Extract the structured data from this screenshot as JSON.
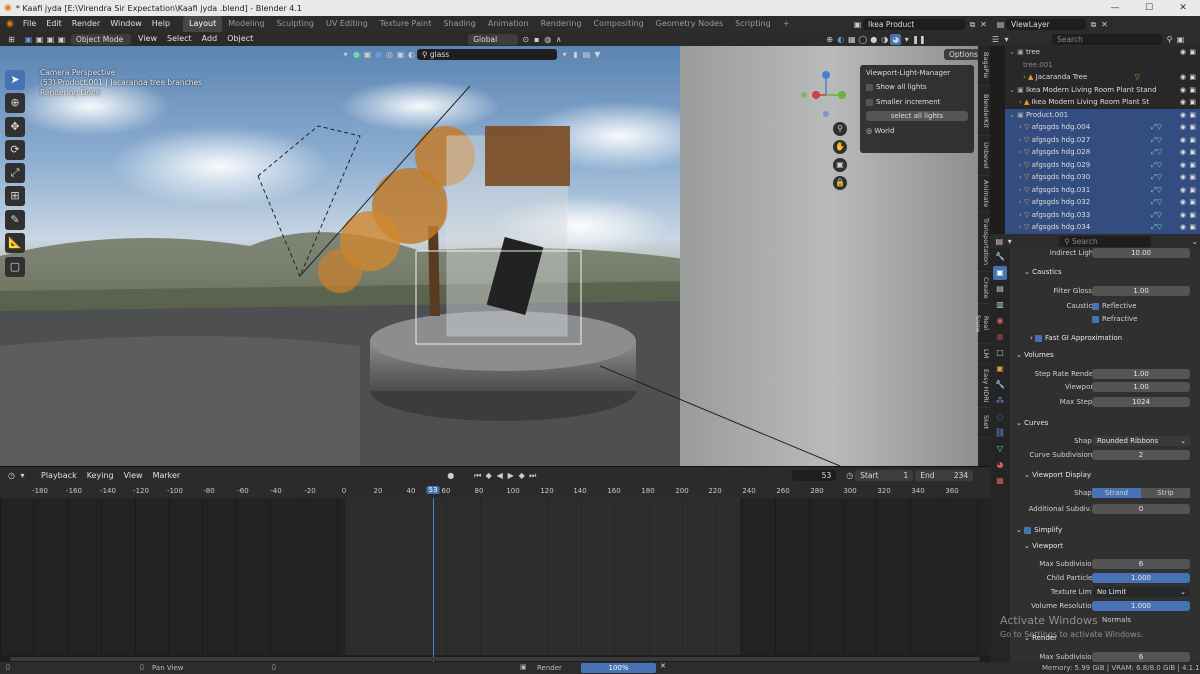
{
  "window": {
    "title": "* Kaafi jyda  [E:\\Virendra Sir Expectation\\Kaafi jyda .blend] - Blender 4.1"
  },
  "menu": [
    "File",
    "Edit",
    "Render",
    "Window",
    "Help"
  ],
  "workspaces": [
    "Layout",
    "Modeling",
    "Sculpting",
    "UV Editing",
    "Texture Paint",
    "Shading",
    "Animation",
    "Rendering",
    "Compositing",
    "Geometry Nodes",
    "Scripting"
  ],
  "topright": {
    "scene": "Ikea Product Visualization...",
    "view_layer": "ViewLayer"
  },
  "viewport_header": {
    "mode": "Object Mode",
    "menus": [
      "View",
      "Select",
      "Add",
      "Object"
    ],
    "orientation": "Global",
    "search_value": "glass",
    "options": "Options"
  },
  "viewport": {
    "line1": "Camera Perspective",
    "line2": "(53) Product.001 | Jacaranda tree branches",
    "line3": "Rendering Done"
  },
  "vlm_panel": {
    "title": "Viewport-Light-Manager",
    "show_all": "Show all lights",
    "smaller": "Smaller increment",
    "select_all": "select all lights",
    "world": "World"
  },
  "sidetabs": [
    "BagaPie",
    "BlenderKit",
    "Unbevel",
    "Animate",
    "Transportation",
    "Create",
    "Real Snow",
    "LM",
    "Easy HDRI",
    "Sket"
  ],
  "timeline": {
    "menus": [
      "Playback",
      "Keying",
      "View",
      "Marker"
    ],
    "current_frame": "53",
    "start_label": "Start",
    "start": "1",
    "end_label": "End",
    "end": "234",
    "ruler": [
      "-180",
      "-160",
      "-140",
      "-120",
      "-100",
      "-80",
      "-60",
      "-40",
      "-20",
      "0",
      "20",
      "40",
      "53",
      "60",
      "80",
      "100",
      "120",
      "140",
      "160",
      "180",
      "200",
      "220",
      "240",
      "260",
      "280",
      "300",
      "320",
      "340",
      "360"
    ]
  },
  "status": {
    "pan": "Pan View",
    "render": "Render",
    "progress": "100%",
    "memory": "Memory: 5.99 GiB | VRAM: 6.8/8.0 GiB | 4.1.1",
    "progress_value": 1.0
  },
  "outliner": {
    "search_placeholder": "Search",
    "items": [
      {
        "label": "tree",
        "sel": false
      },
      {
        "label": "tree.001",
        "sel": false
      },
      {
        "label": "Jacaranda Tree",
        "sel": false
      },
      {
        "label": "Ikea Modern Living Room Plant Stand",
        "sel": false
      },
      {
        "label": "Ikea Modern Living Room Plant St",
        "sel": false
      },
      {
        "label": "Product.001",
        "sel": true
      },
      {
        "label": "afgsgds hdg.004",
        "sel": true
      },
      {
        "label": "afgsgds hdg.027",
        "sel": true
      },
      {
        "label": "afgsgds hdg.028",
        "sel": true
      },
      {
        "label": "afgsgds hdg.029",
        "sel": true
      },
      {
        "label": "afgsgds hdg.030",
        "sel": true
      },
      {
        "label": "afgsgds hdg.031",
        "sel": true
      },
      {
        "label": "afgsgds hdg.032",
        "sel": true
      },
      {
        "label": "afgsgds hdg.033",
        "sel": true
      },
      {
        "label": "afgsgds hdg.034",
        "sel": true
      }
    ]
  },
  "properties": {
    "search_placeholder": "Search",
    "indirect_light_label": "Indirect Light",
    "indirect_light": "10.00",
    "caustics_section": "Caustics",
    "filter_glossy_label": "Filter Glossy",
    "filter_glossy": "1.00",
    "caustics_label": "Caustics",
    "reflective": "Reflective",
    "refractive": "Refractive",
    "fast_gi": "Fast GI Approximation",
    "volumes_section": "Volumes",
    "step_rate_render_label": "Step Rate Render",
    "step_rate_render": "1.00",
    "viewport_label": "Viewport",
    "viewport_val": "1.00",
    "max_steps_label": "Max Steps",
    "max_steps": "1024",
    "curves_section": "Curves",
    "shape_label": "Shape",
    "shape": "Rounded Ribbons",
    "curve_subdiv_label": "Curve Subdivisions",
    "curve_subdiv": "2",
    "viewport_display_section": "Viewport Display",
    "shape2_label": "Shape",
    "strand": "Strand",
    "strip": "Strip",
    "add_subdiv_label": "Additional Subdiv...",
    "add_subdiv": "0",
    "simplify_section": "Simplify",
    "viewport_section": "Viewport",
    "max_subdiv_label": "Max Subdivision",
    "max_subdiv": "6",
    "child_particles_label": "Child Particles",
    "child_particles": "1.000",
    "texture_limit_label": "Texture Limit",
    "texture_limit": "No Limit",
    "volume_res_label": "Volume Resolution",
    "volume_res": "1.000",
    "normals": "Normals",
    "render_section": "Render",
    "max_subdiv2_label": "Max Subdivision",
    "max_subdiv2": "6"
  },
  "watermark": {
    "line1": "Activate Windows",
    "line2": "Go to Settings to activate Windows."
  }
}
